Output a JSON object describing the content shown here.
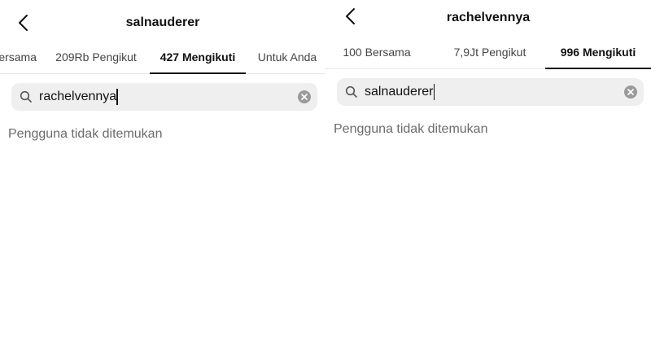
{
  "left": {
    "title": "salnauderer",
    "tabs": [
      {
        "label": "Bersama"
      },
      {
        "label": "209Rb Pengikut"
      },
      {
        "label": "427 Mengikuti",
        "active": true
      },
      {
        "label": "Untuk Anda"
      }
    ],
    "search": {
      "value": "rachelvennya"
    },
    "empty_message": "Pengguna tidak ditemukan"
  },
  "right": {
    "title": "rachelvennya",
    "tabs": [
      {
        "label": "100 Bersama"
      },
      {
        "label": "7,9Jt Pengikut"
      },
      {
        "label": "996 Mengikuti",
        "active": true
      }
    ],
    "search": {
      "value": "salnauderer"
    },
    "empty_message": "Pengguna tidak ditemukan"
  },
  "icons": {
    "back": "chevron-left-icon",
    "search": "search-icon",
    "clear": "clear-x-circle-icon"
  }
}
